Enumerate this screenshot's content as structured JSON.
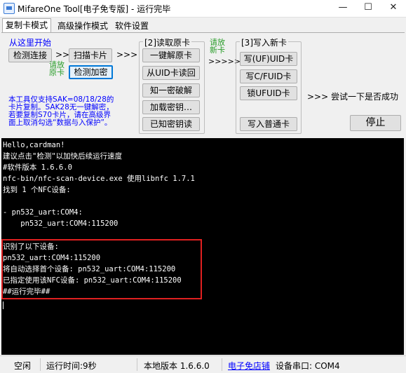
{
  "window": {
    "title": "MifareOne Tool[电子免专版] - 运行完毕",
    "minimize_glyph": "—",
    "maximize_glyph": "☐",
    "close_glyph": "✕"
  },
  "tabs": [
    {
      "label": "复制卡模式"
    },
    {
      "label": "高级操作模式"
    },
    {
      "label": "软件设置"
    }
  ],
  "copy_mode": {
    "start_label": "从这里开始",
    "detect_button": "检测连接",
    "arrow1": ">>",
    "scan_button": "扫描卡片",
    "arrow2": ">>>",
    "place_card_line1": "请放",
    "place_card_line2": "原卡",
    "check_encrypt_button": "检测加密",
    "note_line1": "本工具仅支持SAK=08/18/28的",
    "note_line2": "卡片复制。SAK28无一键解密，",
    "note_line3": "若要复制S70卡片，请在高级界",
    "note_line4": "面上取消勾选“数据与入保护”。"
  },
  "read_group": {
    "header": "[2]读取原卡",
    "buttons": [
      "一键解原卡",
      "从UID卡读回",
      "知一密破解",
      "加载密钥…",
      "已知密钥读"
    ]
  },
  "middle": {
    "place_new_line1": "请放",
    "place_new_line2": "新卡",
    "arrows": ">>>>>"
  },
  "write_group": {
    "header": "[3]写入新卡",
    "buttons": [
      "写(UF)UID卡",
      "写C/FUID卡",
      "锁UFUID卡",
      "写入普通卡"
    ]
  },
  "hint": ">>> 尝试一下是否成功",
  "stop_button": "停止",
  "console": {
    "lines": [
      "Hello,cardman!",
      "建议点击\"检测\"以加快后续运行速度",
      "#软件版本 1.6.6.0",
      "nfc-bin/nfc-scan-device.exe 使用libnfc 1.7.1",
      "找到 1 个NFC设备:",
      "",
      "- pn532_uart:COM4:",
      "    pn532_uart:COM4:115200",
      "",
      "识别了以下设备:",
      "pn532_uart:COM4:115200",
      "将自动选择首个设备: pn532_uart:COM4:115200",
      "已指定使用该NFC设备: pn532_uart:COM4:115200",
      "##运行完毕##"
    ]
  },
  "status": {
    "state": "空闲",
    "runtime": "运行时间:9秒",
    "version": "本地版本 1.6.6.0",
    "shop_link": "电子免店铺",
    "port": "设备串口: COM4"
  },
  "colors": {
    "accent_blue": "#0000ff",
    "green_hint": "#2a9d2a",
    "highlight_red": "#e02020",
    "console_bg": "#000000"
  }
}
